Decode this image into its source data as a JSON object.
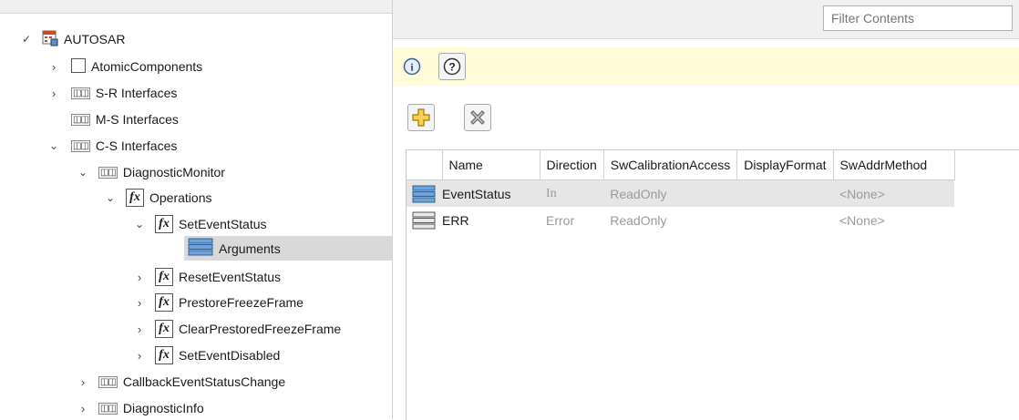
{
  "tree": {
    "root": "AUTOSAR",
    "items": [
      {
        "label": "AtomicComponents"
      },
      {
        "label": "S-R Interfaces"
      },
      {
        "label": "M-S Interfaces"
      },
      {
        "label": "C-S Interfaces"
      },
      {
        "label": "DiagnosticMonitor"
      },
      {
        "label": "Operations"
      },
      {
        "label": "SetEventStatus"
      },
      {
        "label": "Arguments"
      },
      {
        "label": "ResetEventStatus"
      },
      {
        "label": "PrestoreFreezeFrame"
      },
      {
        "label": "ClearPrestoredFreezeFrame"
      },
      {
        "label": "SetEventDisabled"
      },
      {
        "label": "CallbackEventStatusChange"
      },
      {
        "label": "DiagnosticInfo"
      }
    ]
  },
  "filter": {
    "placeholder": "Filter Contents"
  },
  "table": {
    "headers": [
      "Name",
      "Direction",
      "SwCalibrationAccess",
      "DisplayFormat",
      "SwAddrMethod"
    ],
    "rows": [
      {
        "name": "EventStatus",
        "direction": "In",
        "access": "ReadOnly",
        "format": "",
        "addr": "<None>"
      },
      {
        "name": "ERR",
        "direction": "Error",
        "access": "ReadOnly",
        "format": "",
        "addr": "<None>"
      }
    ]
  },
  "colors": {
    "info_bar": "#fffbd9",
    "selection": "#d9d9d9",
    "accent_blue": "#3a78c0"
  }
}
